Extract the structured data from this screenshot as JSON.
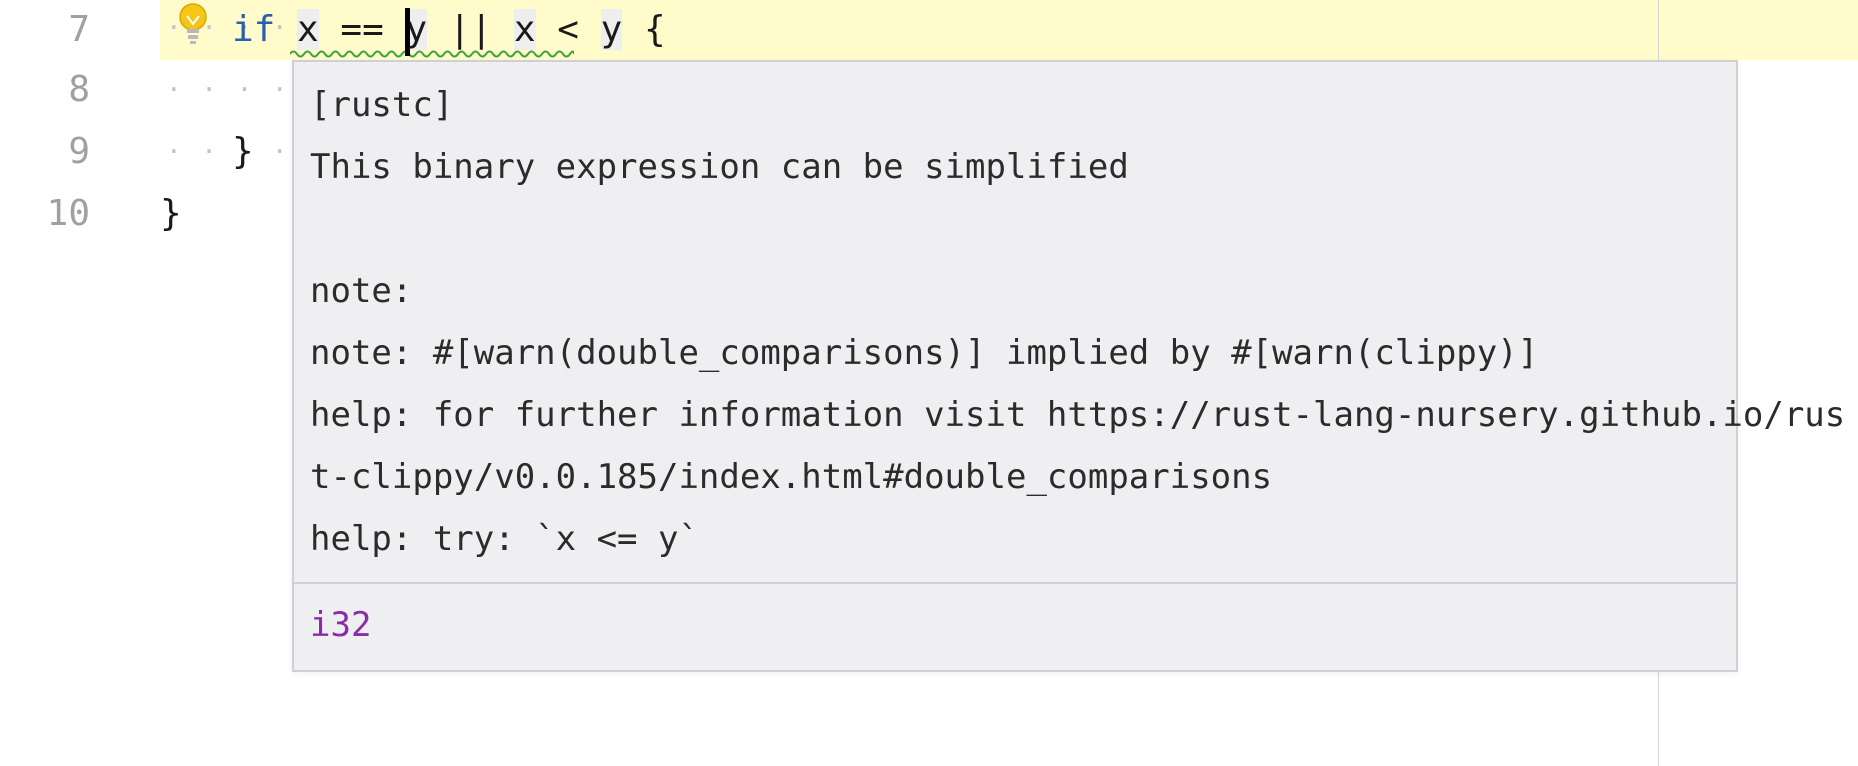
{
  "editor": {
    "lines": [
      {
        "number": "7",
        "tokens": {
          "keyword": "if",
          "left": "x",
          "op1": "==",
          "right": "y",
          "or": "||",
          "left2": "x",
          "op2": "<",
          "right2": "y",
          "brace": "{"
        }
      },
      {
        "number": "8"
      },
      {
        "number": "9",
        "text": "}"
      },
      {
        "number": "10",
        "text": "}"
      }
    ],
    "whitespace_dots": "· · · ·",
    "whitespace_dots_long": "· · · · · · · ·"
  },
  "popup": {
    "lines": [
      "[rustc]",
      "This binary expression can be simplified",
      "",
      "note:",
      "note: #[warn(double_comparisons)] implied by #[warn(clippy)]",
      "help: for further information visit https://rust-lang-nursery.github.io/rus",
      "t-clippy/v0.0.185/index.html#double_comparisons",
      "help: try: `x <= y`"
    ],
    "type_label": "i32"
  },
  "colors": {
    "current_line": "#fffbcb",
    "keyword": "#2a5fb0",
    "type": "#8a2ba8",
    "squiggle": "#3fa33f",
    "bulb": "#f5c518"
  },
  "icons": {
    "intention": "lightbulb-icon"
  }
}
